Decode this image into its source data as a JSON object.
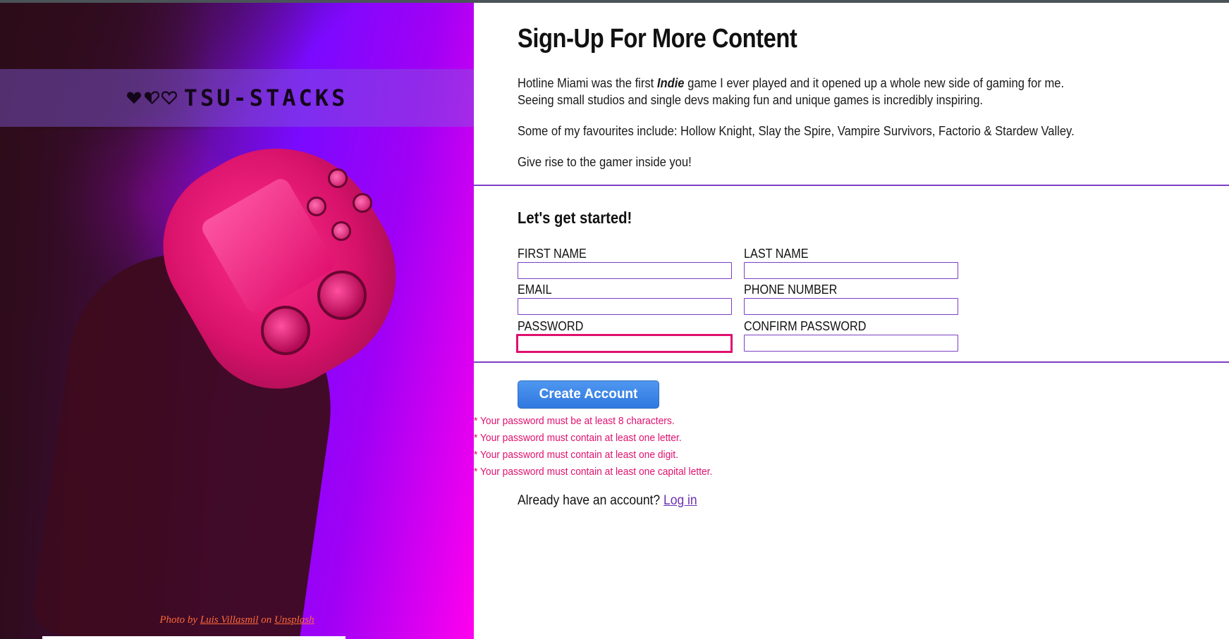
{
  "colors": {
    "accent_purple": "#7b3fc4",
    "error_pink": "#e0106e",
    "button_blue": "#3a86ea",
    "credit_orange": "#ff6a3a"
  },
  "hero": {
    "logo_text": "TSU-STACKS",
    "hearts": [
      "heart-full-icon",
      "heart-half-icon",
      "heart-empty-icon"
    ],
    "credit": {
      "prefix": "Photo by",
      "author": "Luis Villasmil",
      "middle": "on",
      "site": "Unsplash"
    }
  },
  "content": {
    "title": "Sign-Up For More Content",
    "intro": {
      "line1_before": "Hotline Miami was the first ",
      "line1_emphasis": "Indie",
      "line1_after": " game I ever played and it opened up a whole new side of gaming for me.",
      "line2": "Seeing small studios and single devs making fun and unique games is incredibly inspiring.",
      "favourites": "Some of my favourites include: Hollow Knight, Slay the Spire, Vampire Survivors, Factorio & Stardew Valley.",
      "call": "Give rise to the gamer inside you!"
    }
  },
  "form": {
    "heading": "Let's get started!",
    "fields": {
      "first_name": {
        "label": "FIRST NAME",
        "value": ""
      },
      "last_name": {
        "label": "LAST NAME",
        "value": ""
      },
      "email": {
        "label": "EMAIL",
        "value": ""
      },
      "phone": {
        "label": "PHONE NUMBER",
        "value": ""
      },
      "password": {
        "label": "PASSWORD",
        "value": ""
      },
      "confirm_password": {
        "label": "CONFIRM PASSWORD",
        "value": ""
      }
    },
    "submit_label": "Create Account",
    "errors": [
      "* Your password must be at least 8 characters.",
      "* Your password must contain at least one letter.",
      "* Your password must contain at least one digit.",
      "* Your password must contain at least one capital letter."
    ],
    "login_prompt": "Already have an account?",
    "login_link": "Log in"
  }
}
